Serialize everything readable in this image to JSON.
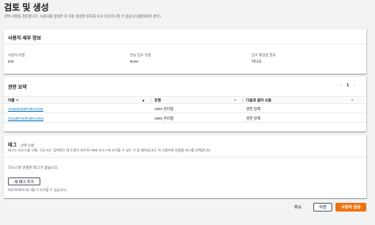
{
  "page": {
    "title": "검토 및 생성",
    "description": "선택 사항을 검토합니다. 사용자를 생성한 후 자동 생성된 암호를 보고 다운로드할 수 있습니다(활성화된 경우)."
  },
  "user_details": {
    "title": "사용자 세부 정보",
    "fields": [
      {
        "label": "사용자 이름",
        "value": "test"
      },
      {
        "label": "콘솔 암호 유형",
        "value": "None"
      },
      {
        "label": "암호 재설정 필요",
        "value": "아니요"
      }
    ]
  },
  "permissions": {
    "title": "권한 요약",
    "page_number": "1",
    "columns": {
      "name": "이름",
      "type": "유형",
      "used_as": "다음과 같이 사용"
    },
    "rows": [
      {
        "name": "AmazonS3FullAccess",
        "type": "AWS 관리형",
        "used_as": "권한 정책"
      },
      {
        "name": "CloudFrontFullAccess",
        "type": "AWS 관리형",
        "used_as": "권한 정책"
      }
    ]
  },
  "tags": {
    "title": "태그",
    "optional": "- 선택 사항",
    "description": "태그는 리소스를 식별, 구성 또는 검색하는 데 도움이 되도록 AWS 리소스에 추가할 수 있는 키 값 페어입니다. 이 사용자와 연결할 태그를 선택합니다.",
    "empty_text": "리소스와 연결된 태그가 없습니다.",
    "add_button": "새 태그 추가",
    "limit_text": "최대 50개의 태그를 더 추가할 수 있습니다."
  },
  "footer": {
    "cancel": "취소",
    "previous": "이전",
    "create": "사용자 생성"
  },
  "colors": {
    "primary": "#ec7211",
    "link": "#0073bb"
  }
}
